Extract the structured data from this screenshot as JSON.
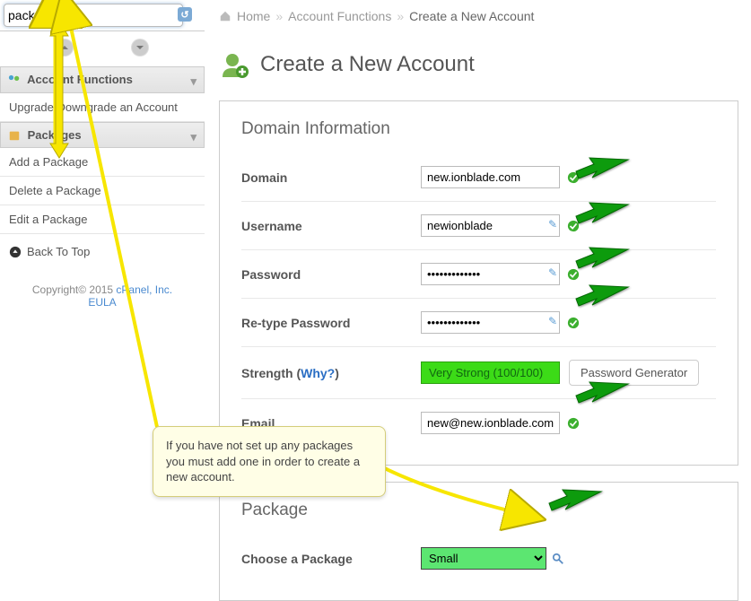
{
  "search": {
    "value": "package"
  },
  "sidebar": {
    "sections": [
      {
        "label": "Account Functions"
      },
      {
        "label": "Packages"
      }
    ],
    "acct_items": [
      {
        "label": "Upgrade/Downgrade an Account"
      }
    ],
    "pkg_items": [
      {
        "label": "Add a Package"
      },
      {
        "label": "Delete a Package"
      },
      {
        "label": "Edit a Package"
      }
    ],
    "back_top": "Back To Top"
  },
  "copyright": {
    "prefix": "Copyright© 2015 ",
    "company": "cPanel, Inc.",
    "eula": "EULA"
  },
  "breadcrumb": {
    "home": "Home",
    "section": "Account Functions",
    "page": "Create a New Account"
  },
  "page_title": "Create a New Account",
  "panel1": {
    "heading": "Domain Information",
    "rows": {
      "domain": {
        "label": "Domain",
        "value": "new.ionblade.com"
      },
      "username": {
        "label": "Username",
        "value": "newionblade"
      },
      "password": {
        "label": "Password",
        "value": "•••••••••••••"
      },
      "retype": {
        "label": "Re-type Password",
        "value": "•••••••••••••"
      },
      "strength": {
        "label_pre": "Strength (",
        "why": "Why?",
        "label_post": ")",
        "badge": "Very Strong (100/100)",
        "gen_btn": "Password Generator"
      },
      "email": {
        "label": "Email",
        "value": "new@new.ionblade.com"
      }
    }
  },
  "panel2": {
    "heading": "Package",
    "rows": {
      "choose": {
        "label": "Choose a Package",
        "value": "Small"
      }
    }
  },
  "tooltip": "If you have not set up any packages you must add one in order to create a new account."
}
